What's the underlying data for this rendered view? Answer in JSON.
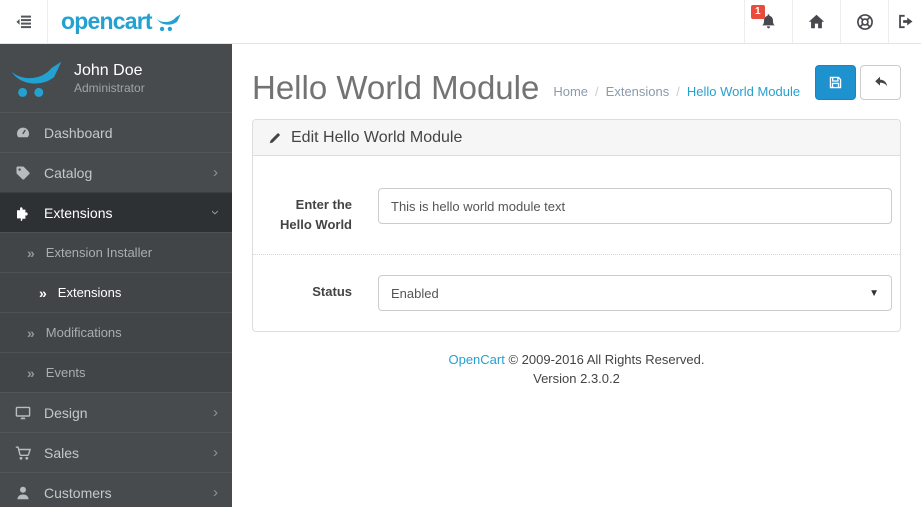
{
  "brand": {
    "logo_text": "opencart",
    "accent_color": "#23a1d1"
  },
  "topbar": {
    "notification_count": "1"
  },
  "sidebar": {
    "profile": {
      "name": "John Doe",
      "role": "Administrator"
    },
    "items": [
      {
        "label": "Dashboard"
      },
      {
        "label": "Catalog"
      },
      {
        "label": "Extensions"
      },
      {
        "label": "Extension Installer"
      },
      {
        "label": "Extensions"
      },
      {
        "label": "Modifications"
      },
      {
        "label": "Events"
      },
      {
        "label": "Design"
      },
      {
        "label": "Sales"
      },
      {
        "label": "Customers"
      }
    ]
  },
  "page": {
    "title": "Hello World Module",
    "breadcrumb": {
      "home": "Home",
      "extensions": "Extensions",
      "current": "Hello World Module"
    }
  },
  "panel": {
    "heading": "Edit Hello World Module"
  },
  "form": {
    "text_label": "Enter the Hello World",
    "text_value": "This is hello world module text",
    "status_label": "Status",
    "status_value": "Enabled"
  },
  "footer": {
    "link_text": "OpenCart",
    "copyright": "© 2009-2016 All Rights Reserved.",
    "version": "Version 2.3.0.2"
  }
}
